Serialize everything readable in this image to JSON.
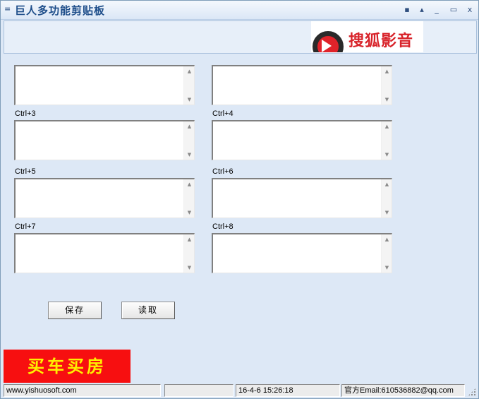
{
  "window": {
    "title": "巨人多功能剪贴板",
    "sys_icon": "=",
    "controls": {
      "pin": "▪",
      "rollup": "▴",
      "minimize": "_",
      "maximize": "▭",
      "close": "x"
    }
  },
  "ads": {
    "top_logo": "搜狐影音",
    "bottom_banner": "买车买房"
  },
  "clips": {
    "labels": [
      "Ctrl+3",
      "Ctrl+4",
      "Ctrl+5",
      "Ctrl+6",
      "Ctrl+7",
      "Ctrl+8"
    ],
    "values": [
      "",
      "",
      "",
      "",
      "",
      "",
      "",
      ""
    ]
  },
  "buttons": {
    "save": "保存",
    "load": "读取"
  },
  "status": {
    "website": "www.yishuosoft.com",
    "blank": "",
    "datetime": "16-4-6 15:26:18",
    "email": "官方Email:610536882@qq.com"
  },
  "colors": {
    "window_bg": "#dde8f6",
    "title_text": "#1e4e8a",
    "ad_red": "#f70f10",
    "ad_yellow": "#ffef00"
  }
}
